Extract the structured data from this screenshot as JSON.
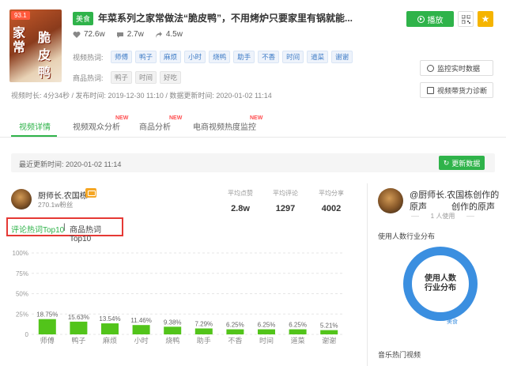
{
  "video": {
    "score": "93.1",
    "thumb_words": [
      "家",
      "常",
      "脆",
      "皮",
      "鸭"
    ],
    "category": "美食",
    "title": "年菜系列之家常做法“脆皮鸭”，不用烤炉只要家里有锅就能...",
    "likes": "72.6w",
    "comments": "2.7w",
    "shares": "4.5w",
    "video_hot_label": "视频热词:",
    "video_hot_words": [
      "师傅",
      "鸭子",
      "麻烦",
      "小时",
      "烧鸭",
      "助手",
      "不香",
      "时间",
      "道菜",
      "谢谢"
    ],
    "goods_hot_label": "商品热词:",
    "goods_hot_words": [
      "鸭子",
      "时间",
      "好吃"
    ],
    "meta": "视频时长: 4分34秒 / 发布时间: 2019-12-30 11:10 / 数据更新时间: 2020-01-02 11:14"
  },
  "actions": {
    "play": "播放",
    "monitor": "监控实时数据",
    "diagnose": "视频带货力诊断"
  },
  "tabs": [
    {
      "label": "视频详情",
      "new": ""
    },
    {
      "label": "视频观众分析",
      "new": "NEW"
    },
    {
      "label": "商品分析",
      "new": "NEW"
    },
    {
      "label": "电商视频热度监控",
      "new": "NEW"
    }
  ],
  "update": {
    "text": "最近更新时间: 2020-01-02 11:14",
    "button": "更新数据"
  },
  "author": {
    "name": "厨师长.农国栋",
    "fans": "270.1w粉丝",
    "metrics": [
      {
        "label": "平均点赞",
        "value": "2.8w"
      },
      {
        "label": "平均评论",
        "value": "1297"
      },
      {
        "label": "平均分享",
        "value": "4002"
      }
    ]
  },
  "toggle": {
    "active": "评论热词Top10",
    "separator": "|",
    "inactive": "商品热词Top10"
  },
  "chart_data": {
    "type": "bar",
    "categories": [
      "师傅",
      "鸭子",
      "麻烦",
      "小时",
      "烧鸭",
      "助手",
      "不香",
      "时间",
      "道菜",
      "谢谢"
    ],
    "values": [
      18.75,
      15.63,
      13.54,
      11.46,
      9.38,
      7.29,
      6.25,
      6.25,
      6.25,
      5.21
    ],
    "value_labels": [
      "18.75%",
      "15.63%",
      "13.54%",
      "11.46%",
      "9.38%",
      "7.29%",
      "6.25%",
      "6.25%",
      "6.25%",
      "5.21%"
    ],
    "yticks": [
      "100%",
      "75%",
      "50%",
      "25%",
      "0"
    ],
    "ylim": [
      0,
      100
    ],
    "grid": true,
    "bar_color": "#52c41a"
  },
  "music": {
    "title": "@厨师长.农国栋创作的",
    "sub1": "原声",
    "sub2": "创作的原声",
    "users": "1 人使用",
    "dist_label": "使用人数行业分布",
    "donut_text_1": "使用人数",
    "donut_text_2": "行业分布",
    "donut_segment": "美食",
    "hot_videos": "音乐热门视频"
  },
  "colors": {
    "accent": "#2fb34a",
    "highlight_border": "#e53935",
    "donut": "#3b8fe0"
  }
}
